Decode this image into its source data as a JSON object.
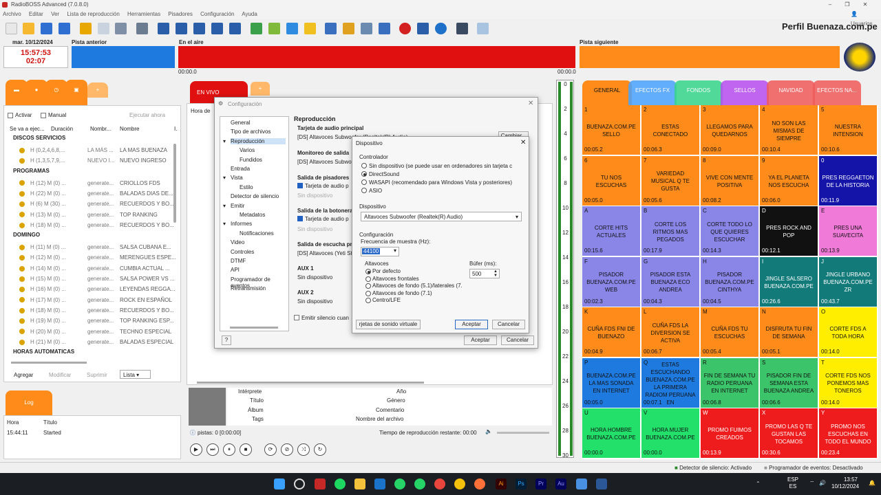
{
  "window": {
    "title": "RadioBOSS Advanced (7.0.8.0)",
    "user": "Usuarios",
    "profile": "Perfil Buenaza.com.pe"
  },
  "menu": [
    "Archivo",
    "Editar",
    "Ver",
    "Lista de reproducción",
    "Herramientas",
    "Pisadores",
    "Configuración",
    "Ayuda"
  ],
  "clock": {
    "date": "mar. 10/12/2024",
    "time": "15:57:53",
    "elapsed": "02:07"
  },
  "panels": {
    "prev": "Pista anterior",
    "on_air": "En el aire",
    "next": "Pista siguiente",
    "start": "00:00.0",
    "end": "00:00.0"
  },
  "scheduler": {
    "activar": "Activar",
    "manual": "Manual",
    "run_now": "Ejecutar ahora",
    "cols": [
      "Se va a ejec...",
      "Duración",
      "Nombr...",
      "Nombre",
      "I."
    ],
    "groups": [
      {
        "name": "DISCOS SERVICIOS",
        "rows": [
          [
            "H (0,2,4,6,8,...",
            "LA MÁS ...",
            "LA MAS BUENAZA"
          ],
          [
            "H (1,3,5,7,9,...",
            "NUEVO I...",
            "NUEVO INGRESO"
          ]
        ]
      },
      {
        "name": "PROGRAMAS",
        "rows": [
          [
            "H (12) M (0) ...",
            "generate...",
            "CRIOLLOS FDS"
          ],
          [
            "H (22) M (0) ...",
            "generate...",
            "BALADAS DIAS DE..."
          ],
          [
            "H (6) M (30) ...",
            "generate...",
            "RECUERDOS Y BO..."
          ],
          [
            "H (13) M (0) ...",
            "generate...",
            "TOP RANKING"
          ],
          [
            "H (18) M (0) ...",
            "generate...",
            "RECUERDOS Y BO..."
          ]
        ]
      },
      {
        "name": "DOMINGO",
        "rows": [
          [
            "H (11) M (0) ...",
            "generate...",
            "SALSA CUBANA E..."
          ],
          [
            "H (12) M (0) ...",
            "generate...",
            "MERENGUES ESPE..."
          ],
          [
            "H (14) M (0) ...",
            "generate...",
            "CUMBIA ACTUAL ..."
          ],
          [
            "H (15) M (0) ...",
            "generate...",
            "SALSA POWER VS ..."
          ],
          [
            "H (16) M (0) ...",
            "generate...",
            "LEYENDAS REGGA..."
          ],
          [
            "H (17) M (0) ...",
            "generate...",
            "ROCK EN ESPAÑOL"
          ],
          [
            "H (18) M (0) ...",
            "generate...",
            "RECUERDOS Y BO..."
          ],
          [
            "H (19) M (0) ...",
            "generate...",
            "TOP RANKING ESP..."
          ],
          [
            "H (20) M (0) ...",
            "generate...",
            "TECHNO ESPECIAL"
          ],
          [
            "H (21) M (0) ...",
            "generate...",
            "BALADAS ESPECIAL"
          ]
        ]
      },
      {
        "name": "HORAS AUTOMATICAS",
        "rows": []
      }
    ],
    "buttons": [
      "Agregar",
      "Modificar",
      "Suprimir",
      "Lista"
    ]
  },
  "log": {
    "tab": "Log",
    "cols": [
      "Hora",
      "Título"
    ],
    "rows": [
      [
        "15:44:11",
        "Started"
      ]
    ]
  },
  "playlist": {
    "tab": "EN VIVO",
    "col": "Hora de"
  },
  "info": {
    "labels": [
      "Intérprete",
      "Título",
      "Álbum",
      "Tags",
      "Año",
      "Género",
      "Comentario",
      "Nombre del archivo"
    ],
    "tracks": "pistas: 0 [0:00:00]",
    "remaining": "Tiempo de reproducción restante: 00:00"
  },
  "meter": [
    "0",
    "2",
    "4",
    "6",
    "8",
    "10",
    "12",
    "14",
    "16",
    "18",
    "20",
    "22",
    "24",
    "26",
    "28",
    "30"
  ],
  "cart_tabs": [
    {
      "label": "GENERAL",
      "color": "#ff8c1a"
    },
    {
      "label": "EFECTOS FX",
      "color": "#4aa3ff"
    },
    {
      "label": "FONDOS",
      "color": "#35d58a"
    },
    {
      "label": "SELLOS",
      "color": "#b84df0"
    },
    {
      "label": "NAVIDAD",
      "color": "#f05a5a"
    },
    {
      "label": "EFECTOS NA...",
      "color": "#f05a5a"
    }
  ],
  "carts": [
    {
      "n": "1",
      "t": "BUENAZA.COM.PE SELLO",
      "d": "00:05.2",
      "c": "#ff8c1a",
      "fc": "#111"
    },
    {
      "n": "2",
      "t": "ESTAS CONECTADO",
      "d": "00:06.3",
      "c": "#ff8c1a",
      "fc": "#111"
    },
    {
      "n": "3",
      "t": "LLEGAMOS PARA QUEDARNOS",
      "d": "00:09.0",
      "c": "#ff8c1a",
      "fc": "#111"
    },
    {
      "n": "4",
      "t": "NO SON LAS MISMAS DE SIEMPRE",
      "d": "00:10.4",
      "c": "#ff8c1a",
      "fc": "#111"
    },
    {
      "n": "5",
      "t": "NUESTRA INTENSION",
      "d": "00:10.6",
      "c": "#ff8c1a",
      "fc": "#111"
    },
    {
      "n": "6",
      "t": "TU NOS ESCUCHAS",
      "d": "00:05.0",
      "c": "#ff8c1a",
      "fc": "#111"
    },
    {
      "n": "7",
      "t": "VARIEDAD MUSICAL Q TE GUSTA",
      "d": "00:05.6",
      "c": "#ff8c1a",
      "fc": "#111"
    },
    {
      "n": "8",
      "t": "VIVE CON MENTE POSITIVA",
      "d": "00:08.2",
      "c": "#ff8c1a",
      "fc": "#111"
    },
    {
      "n": "9",
      "t": "YA EL PLANETA NOS ESCUCHA",
      "d": "00:06.0",
      "c": "#ff8c1a",
      "fc": "#111"
    },
    {
      "n": "0",
      "t": "PRES REGGAETON DE LA HISTORIA",
      "d": "00:11.9",
      "c": "#1414a8",
      "fc": "#fff"
    },
    {
      "n": "A",
      "t": "CORTE HITS ACTUALES",
      "d": "00:15.6",
      "c": "#8a86e8",
      "fc": "#111"
    },
    {
      "n": "B",
      "t": "CORTE LOS RITMOS MAS PEGADOS",
      "d": "00:17.9",
      "c": "#8a86e8",
      "fc": "#111"
    },
    {
      "n": "C",
      "t": "CORTE TODO LO QUE QUIERES ESCUCHAR",
      "d": "00:14.3",
      "c": "#8a86e8",
      "fc": "#111"
    },
    {
      "n": "D",
      "t": "PRES ROCK AND POP",
      "d": "00:12.1",
      "c": "#111",
      "fc": "#fff"
    },
    {
      "n": "E",
      "t": "PRES UNA SUAVECITA",
      "d": "00:13.9",
      "c": "#f07ad8",
      "fc": "#111"
    },
    {
      "n": "F",
      "t": "PISADOR BUENAZA.COM.PE WEB",
      "d": "00:02.3",
      "c": "#8a86e8",
      "fc": "#111"
    },
    {
      "n": "G",
      "t": "PISADOR ESTA BUENAZA ECO ANDREA",
      "d": "00:04.3",
      "c": "#8a86e8",
      "fc": "#111"
    },
    {
      "n": "H",
      "t": "PISADOR BUENAZA.COM.PE CINTHYA",
      "d": "00:04.5",
      "c": "#8a86e8",
      "fc": "#111"
    },
    {
      "n": "I",
      "t": "JINGLE SALSERO BUENAZA.COM.PE",
      "d": "00:26.6",
      "c": "#137a7a",
      "fc": "#fff"
    },
    {
      "n": "J",
      "t": "JINGLE URBANO BUENAZA.COM.PE ZR",
      "d": "00:43.7",
      "c": "#137a7a",
      "fc": "#fff"
    },
    {
      "n": "K",
      "t": "CUÑA FDS FNI DE BUENAZO",
      "d": "00:04.9",
      "c": "#ff8c1a",
      "fc": "#111"
    },
    {
      "n": "L",
      "t": "CUÑA FDS LA DIVERSION SE ACTIVA",
      "d": "00:06.7",
      "c": "#ff8c1a",
      "fc": "#111"
    },
    {
      "n": "M",
      "t": "CUÑA FDS TU ESCUCHAS",
      "d": "00:05.4",
      "c": "#ff8c1a",
      "fc": "#111"
    },
    {
      "n": "N",
      "t": "DISFRUTA TU FIN DE SEMANA",
      "d": "00:05.1",
      "c": "#ff8c1a",
      "fc": "#111"
    },
    {
      "n": "O",
      "t": "CORTE FDS A TODA HORA",
      "d": "00:14.0",
      "c": "#ffee00",
      "fc": "#111"
    },
    {
      "n": "P",
      "t": "BUENAZA.COM.PE LA MAS SONADA EN INTERNET",
      "d": "00:05.0",
      "c": "#1f7ae0",
      "fc": "#111"
    },
    {
      "n": "Q",
      "t": "ESTAS ESCUCHANDO BUENAZA.COM.PE LA PRIMERA RADIOM PERUANA EN",
      "d": "00:07.1",
      "c": "#1f7ae0",
      "fc": "#111"
    },
    {
      "n": "R",
      "t": "FIN DE SEMANA TU RADIO PERUANA EN INTERNET",
      "d": "00:06.8",
      "c": "#3cc46a",
      "fc": "#111"
    },
    {
      "n": "S",
      "t": "PISADOR FIN DE SEMANA ESTA BUENAZA ANDREA",
      "d": "00:06.6",
      "c": "#3cc46a",
      "fc": "#111"
    },
    {
      "n": "T",
      "t": "CORTE FDS NOS PONEMOS MAS TONEROS",
      "d": "00:14.0",
      "c": "#ffee00",
      "fc": "#111"
    },
    {
      "n": "U",
      "t": "HORA HOMBRE BUENAZA.COM.PE",
      "d": "00:00.0",
      "c": "#22e06a",
      "fc": "#111"
    },
    {
      "n": "V",
      "t": "HORA MUJER BUENAZA.COM.PE",
      "d": "00:00.0",
      "c": "#22e06a",
      "fc": "#111"
    },
    {
      "n": "W",
      "t": "PROMO FUIMOS CREADOS",
      "d": "00:13.9",
      "c": "#ee1c1c",
      "fc": "#fff"
    },
    {
      "n": "X",
      "t": "PROMO LAS Q TE GUSTAN LAS TOCAMOS",
      "d": "00:30.6",
      "c": "#ee1c1c",
      "fc": "#fff"
    },
    {
      "n": "Y",
      "t": "PROMO NOS ESCUCHAS EN TODO EL MUNDO",
      "d": "00:23.4",
      "c": "#ee1c1c",
      "fc": "#fff"
    }
  ],
  "config": {
    "title": "Configuración",
    "nav": [
      "General",
      "Tipo de archivos",
      "Reproducción",
      "Varios",
      "Fundidos",
      "Entrada",
      "Vista",
      "Estilo",
      "Detector de silencio",
      "Emitir",
      "Metadatos",
      "Informes",
      "Notificaciones",
      "Video",
      "Controles",
      "DTMF",
      "API",
      "Programador de eventos",
      "Retransmisión"
    ],
    "heading": "Reproducción",
    "main_card": "Tarjeta de audio principal",
    "main_val": "[DS] Altavoces Subwoofer (Realtek(R) Audio)",
    "change": "Cambiar...",
    "monitor": "Monitoreo de salida",
    "monitor_val": "[DS] Altavoces Subwo",
    "pis_out": "Salida de pisadores",
    "card_audio": "Tarjeta de audio p",
    "no_device": "Sin dispositivo",
    "btn_out": "Salida de la botonera",
    "listen_out": "Salida de escucha pr",
    "listen_val": "[DS] Altavoces (Yeti St",
    "aux1": "AUX 1",
    "aux1_val": "Sin dispositivo",
    "aux2": "AUX 2",
    "aux2_val": "Sin dispositivo",
    "silence": "Emitir silencio cuan",
    "help": "?",
    "ok": "Aceptar",
    "cancel": "Cancelar"
  },
  "device": {
    "title": "Dispositivo",
    "controller": "Controlador",
    "options": [
      "Sin dispositivo (se puede usar en ordenadores sin tarjeta c",
      "DirectSound",
      "WASAPI (recomendado para Windows Vista y posteriores)",
      "ASIO"
    ],
    "dev_label": "Dispositivo",
    "dev_val": "Altavoces Subwoofer (Realtek(R) Audio)",
    "conf": "Configuración",
    "freq_label": "Frecuencia de muestra (Hz):",
    "freq": "44100",
    "spk_label": "Altavoces",
    "spk": [
      "Por defecto",
      "Altavoces frontales",
      "Altavoces de fondo (5.1)/laterales (7.",
      "Altavoces de fondo (7.1)",
      "Centro/LFE"
    ],
    "buf_label": "Búfer (ms):",
    "buf": "500",
    "virtual": "rjetas de sonido virtuale",
    "ok": "Aceptar",
    "cancel": "Cancelar"
  },
  "statusbar": {
    "silence": "Detector de silencio: Activado",
    "events": "Programador de eventos: Desactivado"
  },
  "taskbar": {
    "lang": "ESP",
    "lang2": "ES",
    "time": "13:57",
    "date": "10/12/2024"
  }
}
